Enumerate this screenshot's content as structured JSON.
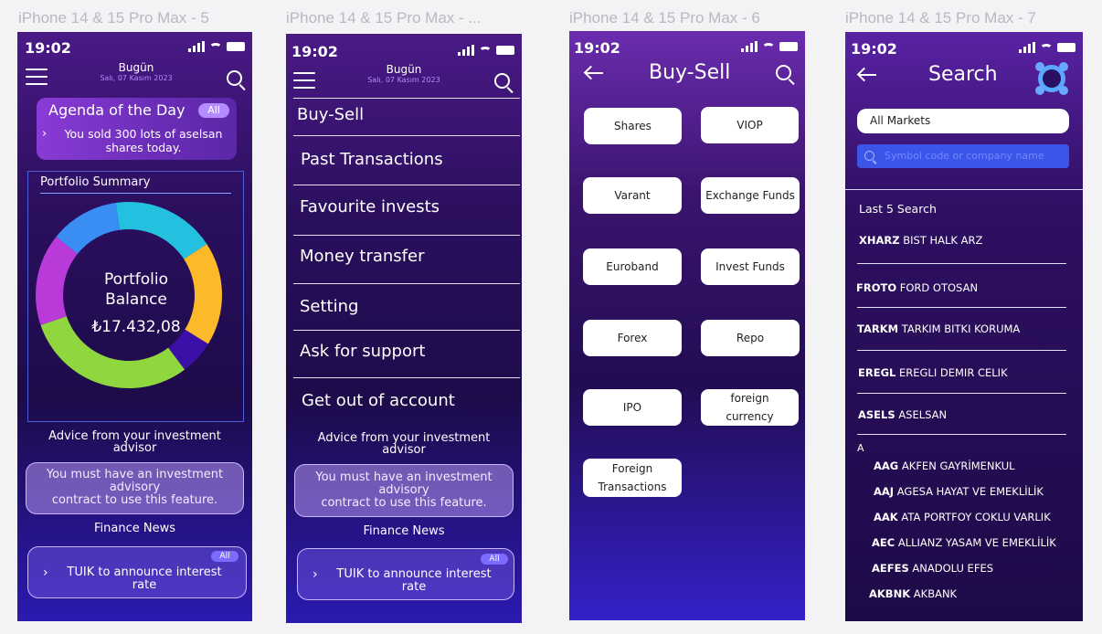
{
  "frames": [
    {
      "title": "iPhone 14 & 15 Pro Max - 5"
    },
    {
      "title": "iPhone 14 & 15 Pro Max - ..."
    },
    {
      "title": "iPhone 14 & 15 Pro Max - 6"
    },
    {
      "title": "iPhone 14 & 15 Pro Max - 7"
    }
  ],
  "status": {
    "time": "19:02"
  },
  "header": {
    "date_title": "Bugün",
    "date_sub": "Salı, 07 Kasım 2023"
  },
  "home": {
    "agenda_title": "Agenda of the Day",
    "agenda_badge": "All",
    "agenda_line1": "You sold 300 lots of aselsan",
    "agenda_line2": "shares today.",
    "portfolio_title": "Portfolio Summary",
    "balance_l1": "Portfolio",
    "balance_l2": "Balance",
    "balance_value": "₺17.432,08",
    "donut": [
      {
        "name": "cyan",
        "value": 18,
        "color": "#23c0df"
      },
      {
        "name": "yellow",
        "value": 18,
        "color": "#fcb929"
      },
      {
        "name": "indigo",
        "value": 6,
        "color": "#3a10a8"
      },
      {
        "name": "green",
        "value": 30,
        "color": "#8fd63f"
      },
      {
        "name": "magenta",
        "value": 16,
        "color": "#b73ad9"
      },
      {
        "name": "blue",
        "value": 12,
        "color": "#3a8df2"
      }
    ],
    "advice_title_1": "Advice from your investment",
    "advice_title_2": "advisor",
    "advice_box_1": "You must have an investment",
    "advice_box_2": "advisory",
    "advice_box_3": "contract to use this feature.",
    "news_title": "Finance News",
    "news_badge": "All",
    "news_line1": "TUIK to announce interest",
    "news_line2": "rate"
  },
  "menu": {
    "items": [
      "Buy-Sell",
      "Past Transactions",
      "Favourite invests",
      "Money transfer",
      "Setting",
      "Ask for support",
      "Get out of account"
    ]
  },
  "buysell": {
    "title": "Buy-Sell",
    "buttons": [
      "Shares",
      "VIOP",
      "Varant",
      "Exchange Funds",
      "Euroband",
      "Invest Funds",
      "Forex",
      "Repo",
      "IPO",
      "foreign currency",
      "Foreign Transactions"
    ]
  },
  "search": {
    "title": "Search",
    "market": "All Markets",
    "placeholder": "Symbol code or company name",
    "last_title": "Last 5 Search",
    "last": [
      {
        "code": "XHARZ",
        "name": "BIST HALK ARZ"
      },
      {
        "code": "FROTO",
        "name": "FORD OTOSAN"
      },
      {
        "code": "TARKM",
        "name": "TARKIM BITKI KORUMA"
      },
      {
        "code": "EREGL",
        "name": "EREGLI DEMIR CELIK"
      },
      {
        "code": "ASELS",
        "name": "ASELSAN"
      }
    ],
    "letter": "A",
    "alpha": [
      {
        "code": "AAG",
        "name": "AKFEN GAYRİMENKUL"
      },
      {
        "code": "AAJ",
        "name": "AGESA HAYAT VE EMEKLİLİK"
      },
      {
        "code": "AAK",
        "name": "ATA PORTFOY COKLU VARLIK"
      },
      {
        "code": "AEC",
        "name": "ALLIANZ YASAM VE EMEKLİLİK"
      },
      {
        "code": "AEFES",
        "name": "ANADOLU EFES"
      },
      {
        "code": "AKBNK",
        "name": "AKBANK"
      }
    ]
  }
}
